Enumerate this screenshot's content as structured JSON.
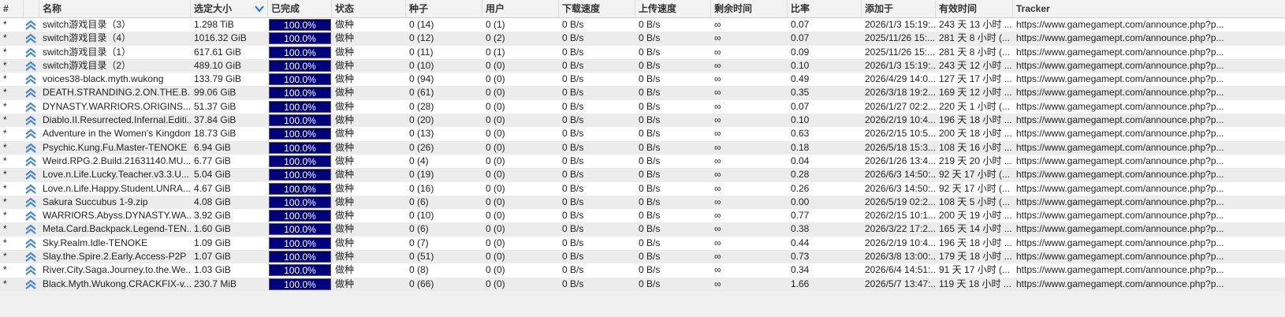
{
  "columns": {
    "num": "#",
    "name": "名称",
    "size": "选定大小",
    "done": "已完成",
    "status": "状态",
    "seeds": "种子",
    "peers": "用户",
    "down": "下载速度",
    "up": "上传速度",
    "eta": "剩余时间",
    "ratio": "比率",
    "added": "添加于",
    "valid": "有效时间",
    "tracker": "Tracker"
  },
  "rows": [
    {
      "num": "*",
      "name": "switch游戏目录（3）",
      "size": "1.298 TiB",
      "done": "100.0%",
      "done_fraction": 1.0,
      "status": "做种",
      "seeds": "0 (14)",
      "peers": "0 (1)",
      "down": "0 B/s",
      "up": "0 B/s",
      "eta": "∞",
      "ratio": "0.07",
      "added": "2026/1/3 15:19:...",
      "valid": "243 天 13 小时 ...",
      "tracker": "https://www.gamegamept.com/announce.php?p..."
    },
    {
      "num": "*",
      "name": "switch游戏目录（4）",
      "size": "1016.32 GiB",
      "done": "100.0%",
      "done_fraction": 1.0,
      "status": "做种",
      "seeds": "0 (12)",
      "peers": "0 (2)",
      "down": "0 B/s",
      "up": "0 B/s",
      "eta": "∞",
      "ratio": "0.07",
      "added": "2025/11/26 15:...",
      "valid": "281 天 8 小时 (...",
      "tracker": "https://www.gamegamept.com/announce.php?p..."
    },
    {
      "num": "*",
      "name": "switch游戏目录（1）",
      "size": "617.61 GiB",
      "done": "100.0%",
      "done_fraction": 1.0,
      "status": "做种",
      "seeds": "0 (11)",
      "peers": "0 (1)",
      "down": "0 B/s",
      "up": "0 B/s",
      "eta": "∞",
      "ratio": "0.09",
      "added": "2025/11/26 15:...",
      "valid": "281 天 8 小时 (...",
      "tracker": "https://www.gamegamept.com/announce.php?p..."
    },
    {
      "num": "*",
      "name": "switch游戏目录（2）",
      "size": "489.10 GiB",
      "done": "100.0%",
      "done_fraction": 1.0,
      "status": "做种",
      "seeds": "0 (10)",
      "peers": "0 (0)",
      "down": "0 B/s",
      "up": "0 B/s",
      "eta": "∞",
      "ratio": "0.10",
      "added": "2026/1/3 15:19:...",
      "valid": "243 天 12 小时 ...",
      "tracker": "https://www.gamegamept.com/announce.php?p..."
    },
    {
      "num": "*",
      "name": "voices38-black.myth.wukong",
      "size": "133.79 GiB",
      "done": "100.0%",
      "done_fraction": 1.0,
      "status": "做种",
      "seeds": "0 (94)",
      "peers": "0 (0)",
      "down": "0 B/s",
      "up": "0 B/s",
      "eta": "∞",
      "ratio": "0.49",
      "added": "2026/4/29 14:0...",
      "valid": "127 天 17 小时 ...",
      "tracker": "https://www.gamegamept.com/announce.php?p..."
    },
    {
      "num": "*",
      "name": "DEATH.STRANDING.2.ON.THE.B...",
      "size": "99.06 GiB",
      "done": "100.0%",
      "done_fraction": 1.0,
      "status": "做种",
      "seeds": "0 (61)",
      "peers": "0 (0)",
      "down": "0 B/s",
      "up": "0 B/s",
      "eta": "∞",
      "ratio": "0.35",
      "added": "2026/3/18 19:2...",
      "valid": "169 天 12 小时 ...",
      "tracker": "https://www.gamegamept.com/announce.php?p..."
    },
    {
      "num": "*",
      "name": "DYNASTY.WARRIORS.ORIGINS....",
      "size": "51.37 GiB",
      "done": "100.0%",
      "done_fraction": 1.0,
      "status": "做种",
      "seeds": "0 (28)",
      "peers": "0 (0)",
      "down": "0 B/s",
      "up": "0 B/s",
      "eta": "∞",
      "ratio": "0.07",
      "added": "2026/1/27 02:2...",
      "valid": "220 天 1 小时 (...",
      "tracker": "https://www.gamegamept.com/announce.php?p..."
    },
    {
      "num": "*",
      "name": "Diablo.II.Resurrected.Infernal.Editi...",
      "size": "37.84 GiB",
      "done": "100.0%",
      "done_fraction": 1.0,
      "status": "做种",
      "seeds": "0 (20)",
      "peers": "0 (0)",
      "down": "0 B/s",
      "up": "0 B/s",
      "eta": "∞",
      "ratio": "0.10",
      "added": "2026/2/19 10:4...",
      "valid": "196 天 18 小时 ...",
      "tracker": "https://www.gamegamept.com/announce.php?p..."
    },
    {
      "num": "*",
      "name": "Adventure in the Women's Kingdom",
      "size": "18.73 GiB",
      "done": "100.0%",
      "done_fraction": 1.0,
      "status": "做种",
      "seeds": "0 (13)",
      "peers": "0 (0)",
      "down": "0 B/s",
      "up": "0 B/s",
      "eta": "∞",
      "ratio": "0.63",
      "added": "2026/2/15 10:5...",
      "valid": "200 天 18 小时 ...",
      "tracker": "https://www.gamegamept.com/announce.php?p..."
    },
    {
      "num": "*",
      "name": "Psychic.Kung.Fu.Master-TENOKE",
      "size": "6.94 GiB",
      "done": "100.0%",
      "done_fraction": 1.0,
      "status": "做种",
      "seeds": "0 (26)",
      "peers": "0 (0)",
      "down": "0 B/s",
      "up": "0 B/s",
      "eta": "∞",
      "ratio": "0.18",
      "added": "2026/5/18 15:3...",
      "valid": "108 天 16 小时 ...",
      "tracker": "https://www.gamegamept.com/announce.php?p..."
    },
    {
      "num": "*",
      "name": "Weird.RPG.2.Build.21631140.MU...",
      "size": "6.77 GiB",
      "done": "100.0%",
      "done_fraction": 1.0,
      "status": "做种",
      "seeds": "0 (4)",
      "peers": "0 (0)",
      "down": "0 B/s",
      "up": "0 B/s",
      "eta": "∞",
      "ratio": "0.04",
      "added": "2026/1/26 13:4...",
      "valid": "219 天 20 小时 ...",
      "tracker": "https://www.gamegamept.com/announce.php?p..."
    },
    {
      "num": "*",
      "name": "Love.n.Life.Lucky.Teacher.v3.3.U...",
      "size": "5.04 GiB",
      "done": "100.0%",
      "done_fraction": 1.0,
      "status": "做种",
      "seeds": "0 (19)",
      "peers": "0 (0)",
      "down": "0 B/s",
      "up": "0 B/s",
      "eta": "∞",
      "ratio": "0.28",
      "added": "2026/6/3 14:50:...",
      "valid": "92 天 17 小时 (...",
      "tracker": "https://www.gamegamept.com/announce.php?p..."
    },
    {
      "num": "*",
      "name": "Love.n.Life.Happy.Student.UNRA...",
      "size": "4.67 GiB",
      "done": "100.0%",
      "done_fraction": 1.0,
      "status": "做种",
      "seeds": "0 (16)",
      "peers": "0 (0)",
      "down": "0 B/s",
      "up": "0 B/s",
      "eta": "∞",
      "ratio": "0.26",
      "added": "2026/6/3 14:50:...",
      "valid": "92 天 17 小时 (...",
      "tracker": "https://www.gamegamept.com/announce.php?p..."
    },
    {
      "num": "*",
      "name": "Sakura Succubus 1-9.zip",
      "size": "4.08 GiB",
      "done": "100.0%",
      "done_fraction": 1.0,
      "status": "做种",
      "seeds": "0 (6)",
      "peers": "0 (0)",
      "down": "0 B/s",
      "up": "0 B/s",
      "eta": "∞",
      "ratio": "0.00",
      "added": "2026/5/19 02:2...",
      "valid": "108 天 5 小时 (...",
      "tracker": "https://www.gamegamept.com/announce.php?p..."
    },
    {
      "num": "*",
      "name": "WARRIORS.Abyss.DYNASTY.WA...",
      "size": "3.92 GiB",
      "done": "100.0%",
      "done_fraction": 1.0,
      "status": "做种",
      "seeds": "0 (10)",
      "peers": "0 (0)",
      "down": "0 B/s",
      "up": "0 B/s",
      "eta": "∞",
      "ratio": "0.77",
      "added": "2026/2/15 10:1...",
      "valid": "200 天 19 小时 ...",
      "tracker": "https://www.gamegamept.com/announce.php?p..."
    },
    {
      "num": "*",
      "name": "Meta.Card.Backpack.Legend-TEN...",
      "size": "1.60 GiB",
      "done": "100.0%",
      "done_fraction": 1.0,
      "status": "做种",
      "seeds": "0 (6)",
      "peers": "0 (0)",
      "down": "0 B/s",
      "up": "0 B/s",
      "eta": "∞",
      "ratio": "0.38",
      "added": "2026/3/22 17:2...",
      "valid": "165 天 14 小时 ...",
      "tracker": "https://www.gamegamept.com/announce.php?p..."
    },
    {
      "num": "*",
      "name": "Sky.Realm.Idle-TENOKE",
      "size": "1.09 GiB",
      "done": "100.0%",
      "done_fraction": 1.0,
      "status": "做种",
      "seeds": "0 (7)",
      "peers": "0 (0)",
      "down": "0 B/s",
      "up": "0 B/s",
      "eta": "∞",
      "ratio": "0.44",
      "added": "2026/2/19 10:4...",
      "valid": "196 天 18 小时 ...",
      "tracker": "https://www.gamegamept.com/announce.php?p..."
    },
    {
      "num": "*",
      "name": "Slay.the.Spire.2.Early.Access-P2P",
      "size": "1.07 GiB",
      "done": "100.0%",
      "done_fraction": 1.0,
      "status": "做种",
      "seeds": "0 (51)",
      "peers": "0 (0)",
      "down": "0 B/s",
      "up": "0 B/s",
      "eta": "∞",
      "ratio": "0.73",
      "added": "2026/3/8 13:00:...",
      "valid": "179 天 18 小时 ...",
      "tracker": "https://www.gamegamept.com/announce.php?p..."
    },
    {
      "num": "*",
      "name": "River.City.Saga.Journey.to.the.We...",
      "size": "1.03 GiB",
      "done": "100.0%",
      "done_fraction": 1.0,
      "status": "做种",
      "seeds": "0 (8)",
      "peers": "0 (0)",
      "down": "0 B/s",
      "up": "0 B/s",
      "eta": "∞",
      "ratio": "0.34",
      "added": "2026/6/4 14:51:...",
      "valid": "91 天 17 小时 (...",
      "tracker": "https://www.gamegamept.com/announce.php?p..."
    },
    {
      "num": "*",
      "name": "Black.Myth.Wukong.CRACKFIX-v...",
      "size": "230.7 MiB",
      "done": "100.0%",
      "done_fraction": 1.0,
      "status": "做种",
      "seeds": "0 (66)",
      "peers": "0 (0)",
      "down": "0 B/s",
      "up": "0 B/s",
      "eta": "∞",
      "ratio": "1.66",
      "added": "2026/5/7 13:47:...",
      "valid": "119 天 18 小时 ...",
      "tracker": "https://www.gamegamept.com/announce.php?p..."
    }
  ],
  "colors": {
    "progress_fill": "#00007a",
    "priority_icon": "#4a86d8",
    "sort_icon": "#1e72d9"
  },
  "icons": {
    "priority": "double-chevron-up-icon",
    "sort": "sort-descending-icon"
  }
}
